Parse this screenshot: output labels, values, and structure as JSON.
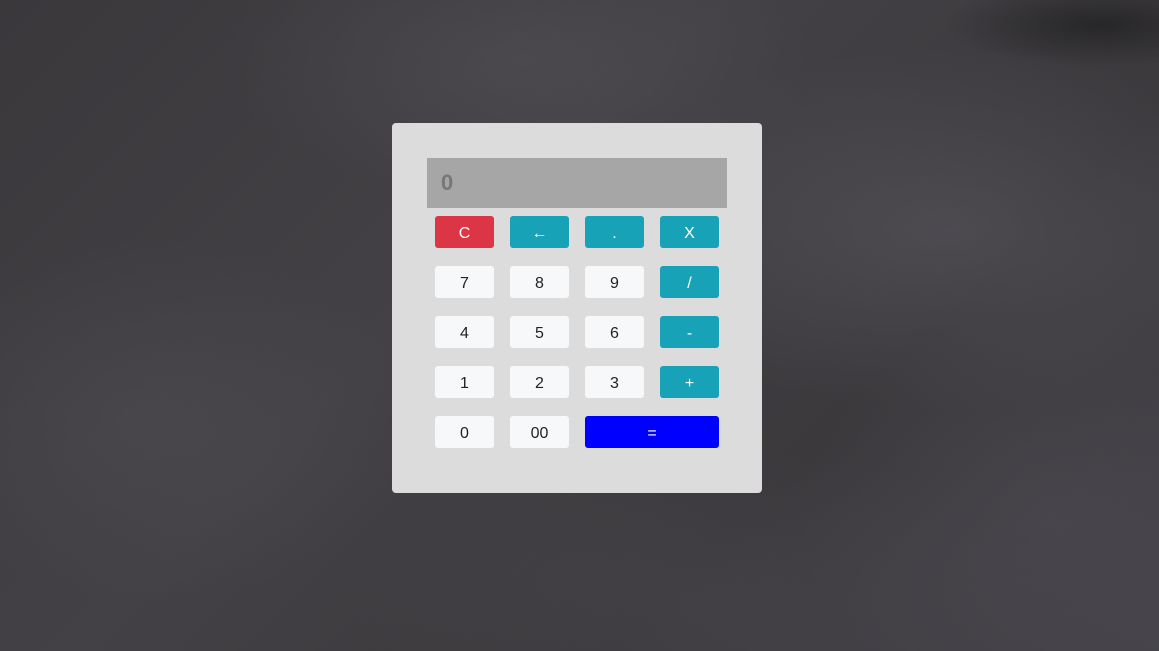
{
  "display": {
    "value": "0"
  },
  "keys": {
    "clear": "C",
    "backspace": "←",
    "decimal": ".",
    "multiply": "X",
    "seven": "7",
    "eight": "8",
    "nine": "9",
    "divide": "/",
    "four": "4",
    "five": "5",
    "six": "6",
    "subtract": "-",
    "one": "1",
    "two": "2",
    "three": "3",
    "add": "+",
    "zero": "0",
    "double_zero": "00",
    "equals": "="
  },
  "colors": {
    "clear_key": "#dc3545",
    "operator_key": "#17a2b8",
    "equals_key": "#0000ff",
    "digit_key": "#f7f8f9",
    "display_bg": "#a6a6a6",
    "panel_bg": "#dcdcdc"
  }
}
